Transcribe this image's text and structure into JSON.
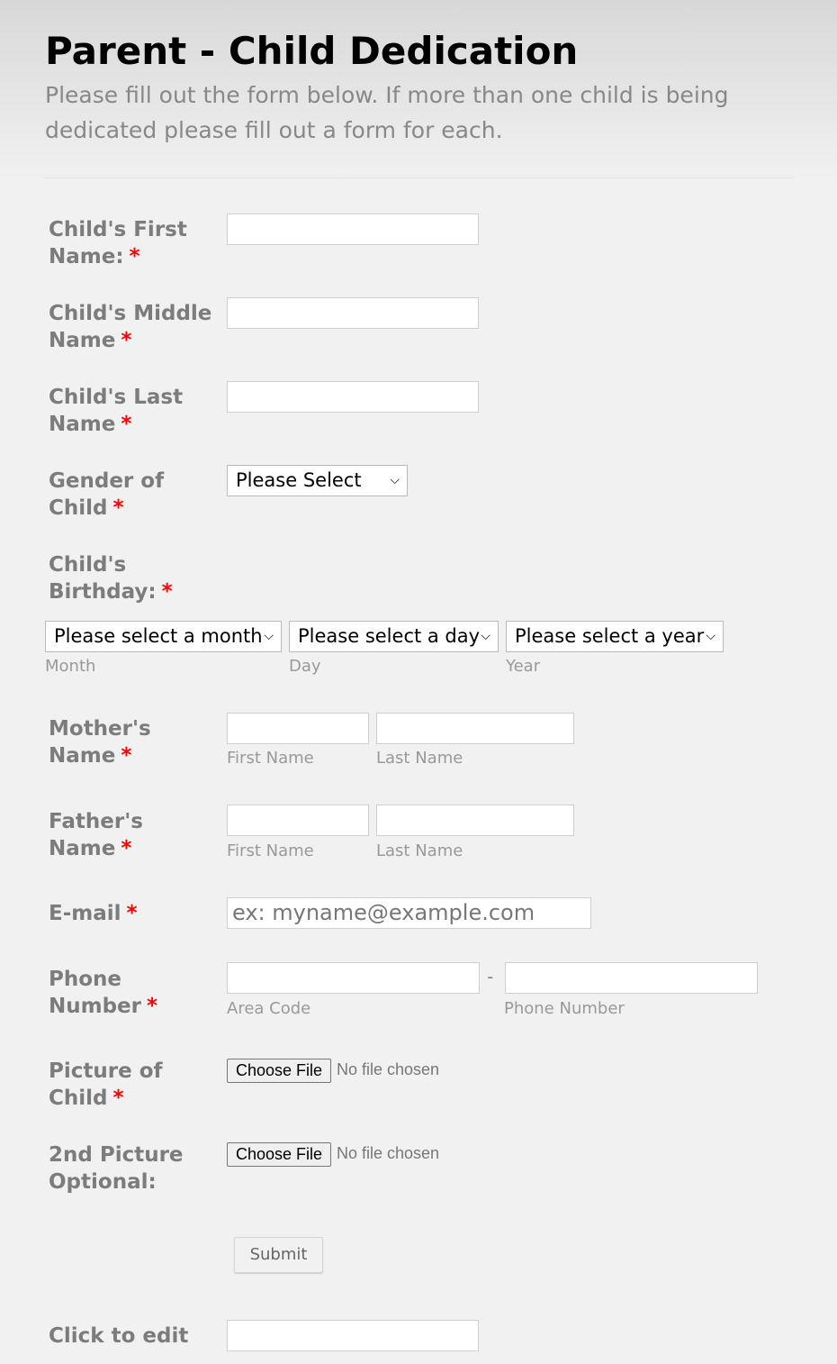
{
  "header": {
    "title": "Parent - Child Dedication",
    "subtitle": "Please fill out the form below. If more than one child is being dedicated please fill out a form for each."
  },
  "required_mark": "*",
  "fields": {
    "first": {
      "label": "Child's First Name:"
    },
    "middle": {
      "label": "Child's Middle Name"
    },
    "last": {
      "label": "Child's Last Name"
    },
    "gender": {
      "label": "Gender of Child",
      "value": "Please Select"
    },
    "birthday": {
      "label": "Child's Birthday:",
      "month": "Please select a month",
      "day": "Please select a day",
      "year": "Please select a year",
      "month_sub": "Month",
      "day_sub": "Day",
      "year_sub": "Year"
    },
    "mother": {
      "label": "Mother's Name",
      "first_sub": "First Name",
      "last_sub": "Last Name"
    },
    "father": {
      "label": "Father's Name",
      "first_sub": "First Name",
      "last_sub": "Last Name"
    },
    "email": {
      "label": "E-mail",
      "placeholder": "ex: myname@example.com"
    },
    "phone": {
      "label": "Phone Number",
      "separator": "-",
      "area_sub": "Area Code",
      "number_sub": "Phone Number"
    },
    "picture": {
      "label": "Picture of Child",
      "button": "Choose File",
      "status": "No file chosen"
    },
    "picture2": {
      "label": "2nd Picture Optional:",
      "button": "Choose File",
      "status": "No file chosen"
    },
    "click_edit": {
      "label": "Click to edit"
    }
  },
  "submit": "Submit"
}
